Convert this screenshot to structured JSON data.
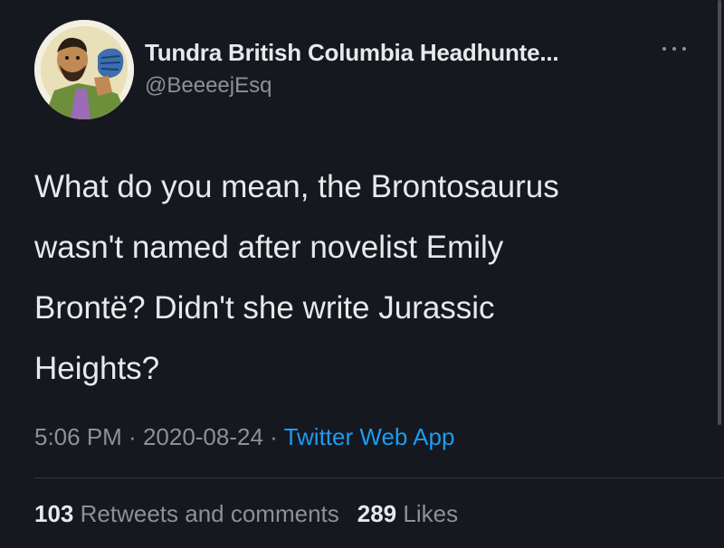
{
  "author": {
    "display_name": "Tundra British Columbia Headhunte...",
    "handle": "@BeeeejEsq",
    "avatar_icon": "cartoon-man-avatar"
  },
  "tweet": {
    "lines": [
      "What do you mean, the Brontosaurus",
      "wasn't named after novelist Emily",
      "Brontë? Didn't she write Jurassic",
      "Heights?"
    ],
    "time": "5:06 PM",
    "separator": " · ",
    "date": "2020-08-24",
    "source": "Twitter Web App"
  },
  "stats": {
    "retweets_count": "103",
    "retweets_label": "Retweets and comments",
    "likes_count": "289",
    "likes_label": "Likes"
  },
  "colors": {
    "background": "#15181e",
    "text": "#e7e9ea",
    "muted": "#8b9198",
    "link": "#1d9bf0"
  }
}
